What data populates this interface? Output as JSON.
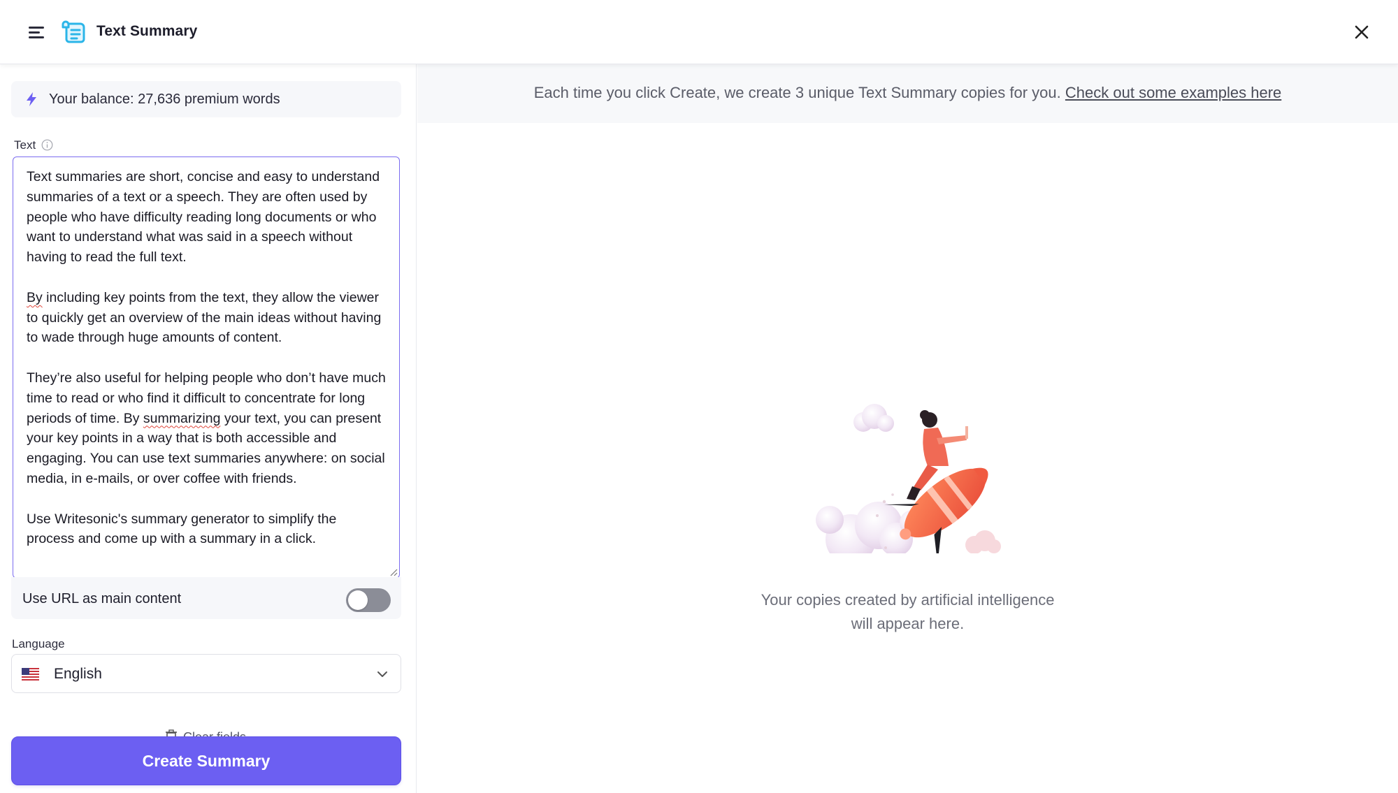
{
  "header": {
    "title": "Text Summary",
    "icons": {
      "menu": "hamburger-menu-icon",
      "logo": "text-summary-logo-icon",
      "close": "close-icon"
    },
    "brand_color": "#2bb5e8"
  },
  "left_panel": {
    "balance_text": "Your balance: 27,636 premium words",
    "balance_icon": "lightning-bolt-icon",
    "text_label": "Text",
    "text_paragraphs": [
      "Text summaries are short, concise and easy to understand summaries of a text or a speech. They are often used by people who have difficulty reading long documents or who want to understand what was said in a speech without having to read the full text.",
      "By including key points from the text, they allow the viewer to quickly get an overview of the main ideas without having to wade through huge amounts of content.",
      "They’re also useful for helping people who don’t have much time to read or who find it difficult to concentrate for long periods of time. By summarizing your text, you can present your key points in a way that is both accessible and engaging. You can use text summaries anywhere: on social media, in e-mails, or over coffee with friends.",
      "Use Writesonic's summary generator to simplify the process and come up with a summary in a click."
    ],
    "url_toggle_label": "Use URL as main content",
    "url_toggle_on": false,
    "language_label": "Language",
    "language_value": "English",
    "clear_fields_label": "Clear fields",
    "create_button_label": "Create Summary",
    "accent_color": "#6c5ff2"
  },
  "right_panel": {
    "info_text": "Each time you click Create, we create 3 unique Text Summary copies for you.",
    "info_link": "Check out some examples here",
    "empty_line1": "Your copies created by artificial intelligence",
    "empty_line2": "will appear here.",
    "illustration": "person-riding-rocket-illustration"
  }
}
